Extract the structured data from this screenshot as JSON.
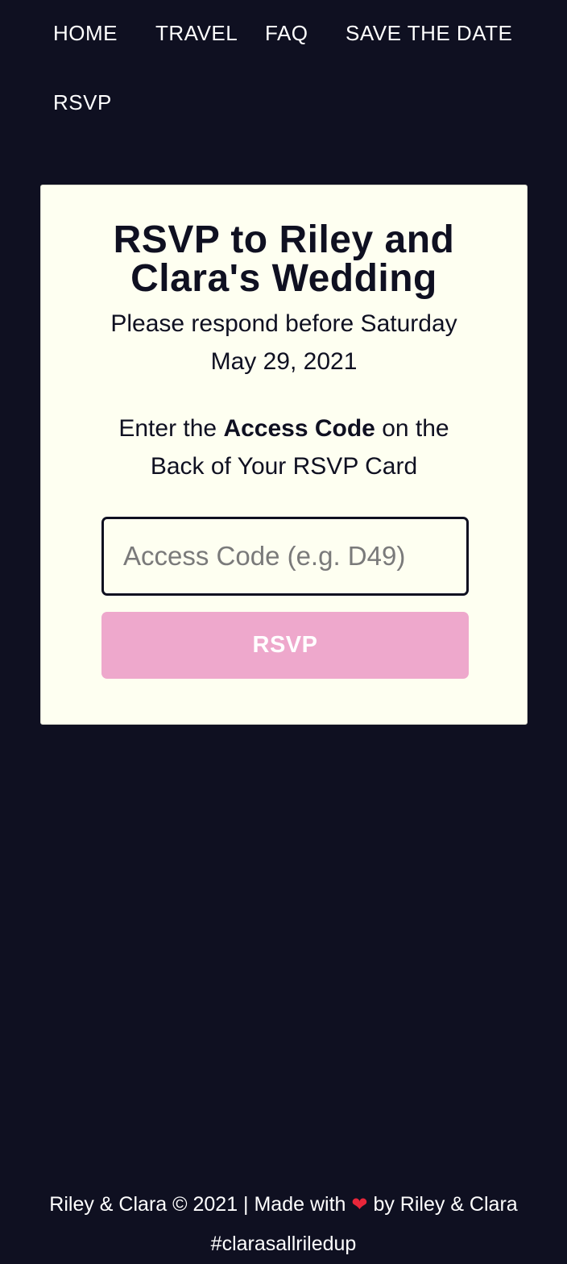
{
  "nav": {
    "items": [
      {
        "label": "HOME"
      },
      {
        "label": "TRAVEL"
      },
      {
        "label": "FAQ"
      },
      {
        "label": "SAVE THE DATE"
      },
      {
        "label": "RSVP"
      }
    ]
  },
  "card": {
    "title": "RSVP to Riley and Clara's Wedding",
    "subtitle": "Please respond before Saturday May 29, 2021",
    "instructions": {
      "prefix": "Enter the ",
      "emphasis": "Access Code",
      "suffix": " on the Back of Your RSVP Card"
    },
    "access_code": {
      "placeholder": "Access Code (e.g. D49)",
      "value": ""
    },
    "submit_label": "RSVP"
  },
  "footer": {
    "credit_prefix": "Riley & Clara © 2021 | Made with",
    "heart_icon": "heart-icon",
    "credit_suffix": "by Riley & Clara",
    "hashtag": "#clarasallriledup"
  },
  "colors": {
    "background": "#0f1021",
    "card": "#fefff1",
    "accent_pink": "#eea8cc",
    "text_dark": "#0f1021",
    "heart": "#e8263a"
  }
}
